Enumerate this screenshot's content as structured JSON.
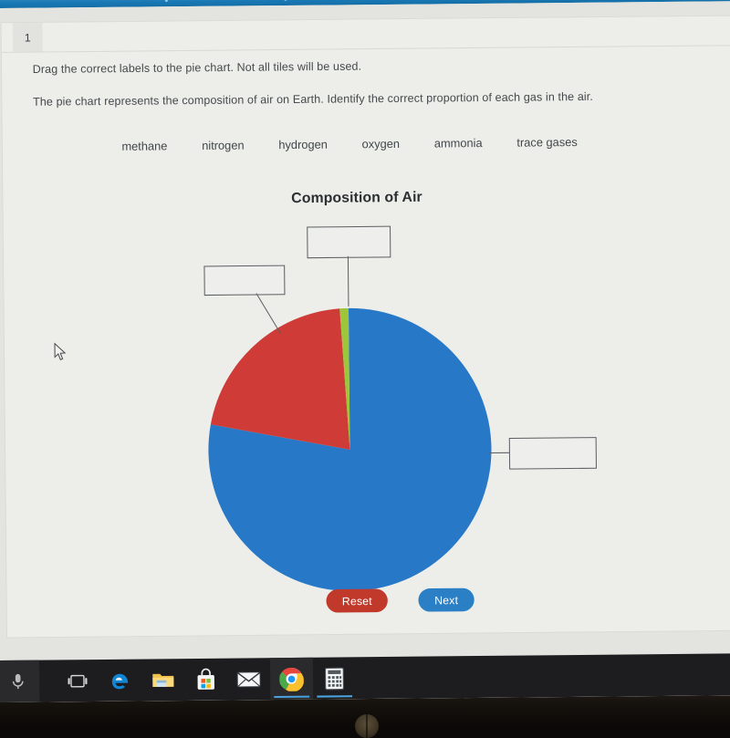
{
  "window": {
    "top_bar_color": "#1878b4",
    "page_background": "#e3e4e0",
    "card_background": "#edeeea"
  },
  "question": {
    "number": "1",
    "instruction": "Drag the correct labels to the pie chart. Not all tiles will be used.",
    "context": "The pie chart represents the composition of air on Earth. Identify the correct proportion of each gas in the air."
  },
  "tiles": [
    {
      "label": "methane"
    },
    {
      "label": "nitrogen"
    },
    {
      "label": "hydrogen"
    },
    {
      "label": "oxygen"
    },
    {
      "label": "ammonia"
    },
    {
      "label": "trace gases"
    }
  ],
  "drop_targets": [
    {
      "id": "top",
      "value": "",
      "points_to": "green-slice"
    },
    {
      "id": "left",
      "value": "",
      "points_to": "red-slice"
    },
    {
      "id": "right",
      "value": "",
      "points_to": "blue-slice"
    }
  ],
  "buttons": {
    "reset_label": "Reset",
    "reset_color": "#c0392b",
    "next_label": "Next",
    "next_color": "#2b7fc4"
  },
  "taskbar": {
    "items": [
      {
        "name": "cortana-microphone-icon",
        "label": "Cortana"
      },
      {
        "name": "task-view-icon",
        "label": "Task View"
      },
      {
        "name": "edge-icon",
        "label": "Microsoft Edge"
      },
      {
        "name": "file-explorer-icon",
        "label": "File Explorer"
      },
      {
        "name": "microsoft-store-icon",
        "label": "Microsoft Store"
      },
      {
        "name": "mail-icon",
        "label": "Mail"
      },
      {
        "name": "chrome-icon",
        "label": "Google Chrome"
      },
      {
        "name": "calculator-icon",
        "label": "Calculator"
      }
    ]
  },
  "chart_data": {
    "type": "pie",
    "title": "Composition of Air",
    "labels": [
      "blue slice",
      "red slice",
      "green slice"
    ],
    "values": [
      78,
      21,
      1
    ],
    "unit": "%",
    "colors": [
      "#2878c8",
      "#cf3b36",
      "#9dc63a"
    ],
    "start_angle_deg": 0,
    "direction": "clockwise",
    "legend": "none",
    "data_labels": "none",
    "notes": "Slice labels are blank drop-target boxes joined to the pie by leader lines; the learner drags word tiles into them."
  }
}
